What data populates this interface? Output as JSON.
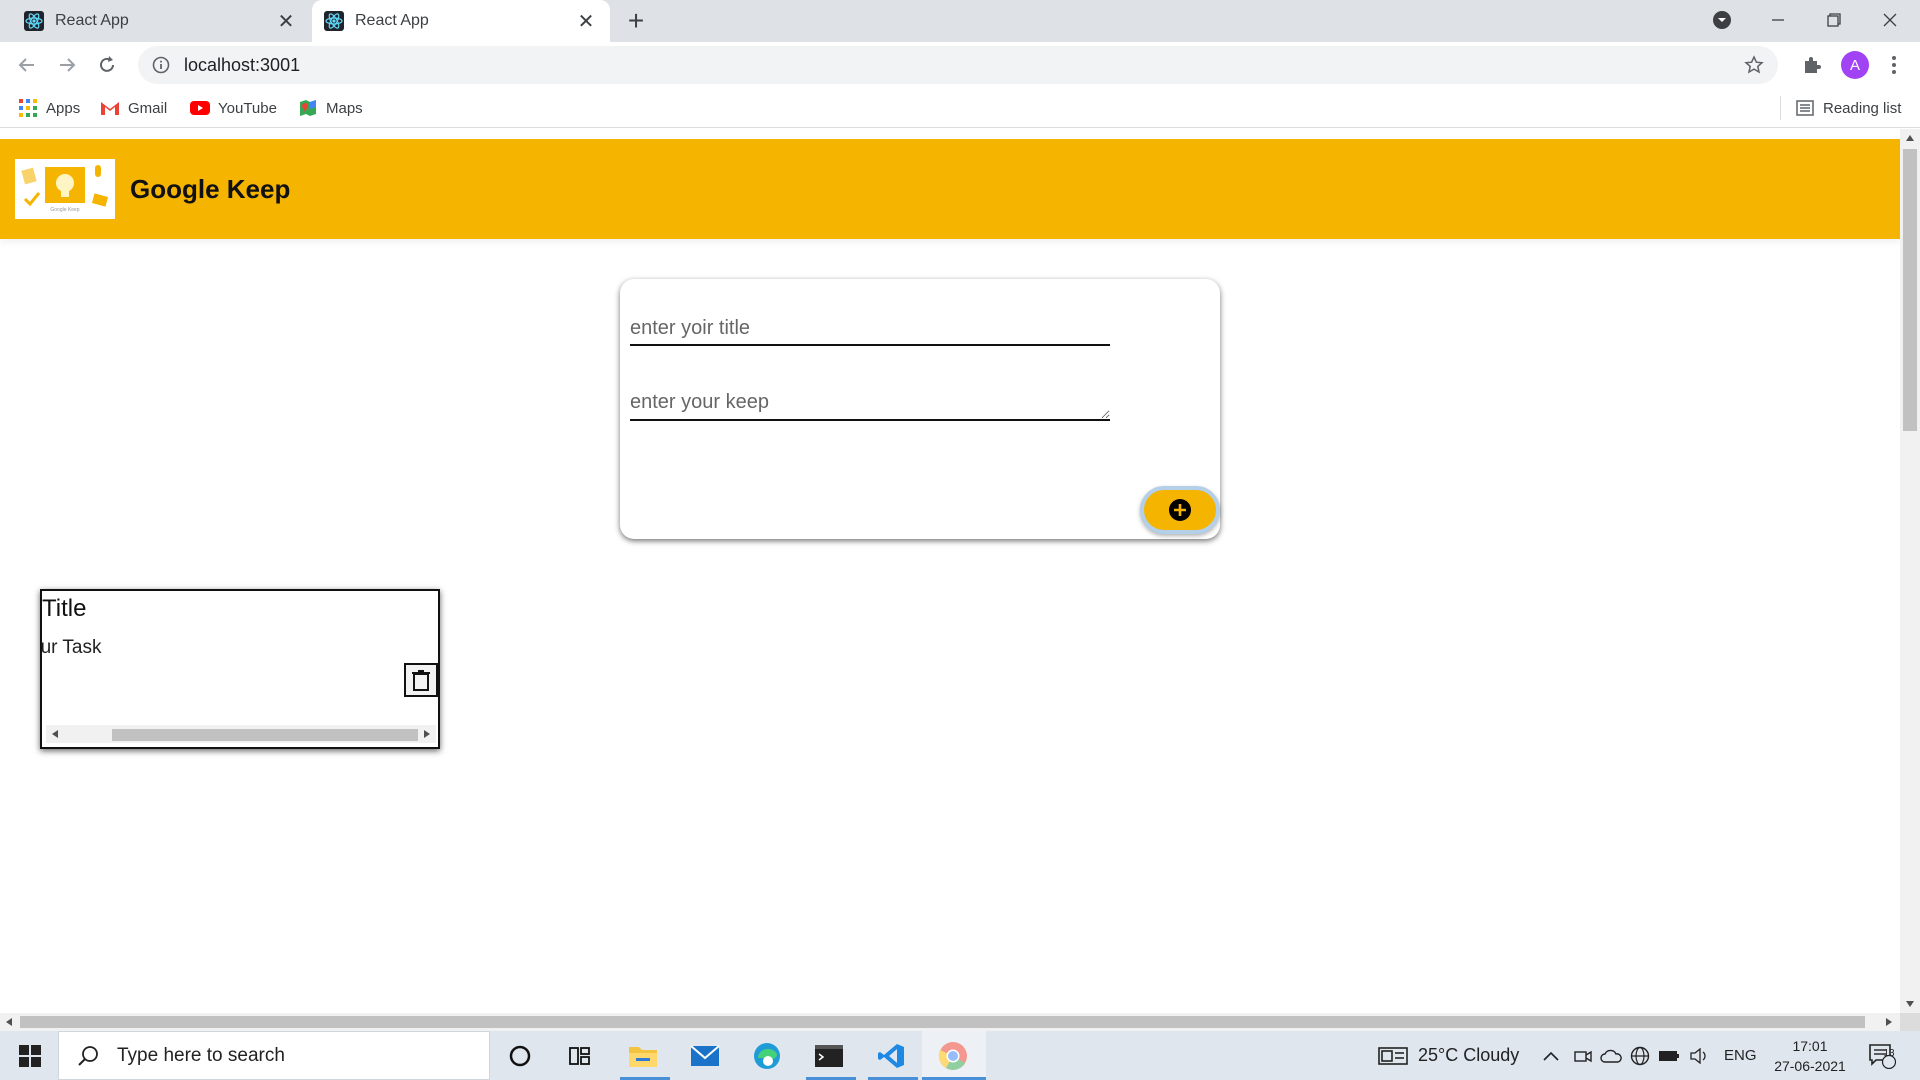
{
  "browser": {
    "tabs": [
      {
        "title": "React App",
        "active": false
      },
      {
        "title": "React App",
        "active": true
      }
    ],
    "url": "localhost:3001",
    "profile_initial": "A",
    "bookmarks": [
      {
        "label": "Apps"
      },
      {
        "label": "Gmail"
      },
      {
        "label": "YouTube"
      },
      {
        "label": "Maps"
      }
    ],
    "reading_list": "Reading list"
  },
  "app": {
    "brand": "Google Keep",
    "form": {
      "title_placeholder": "enter yoir title",
      "keep_placeholder": "enter your keep"
    },
    "notes": [
      {
        "title": "Title",
        "body": "our Task"
      }
    ]
  },
  "taskbar": {
    "search_placeholder": "Type here to search",
    "weather": "25°C  Cloudy",
    "lang": "ENG",
    "time": "17:01",
    "date": "27-06-2021",
    "notification_count": "13"
  },
  "colors": {
    "header": "#f5b400",
    "add_button": "#f5b400"
  }
}
